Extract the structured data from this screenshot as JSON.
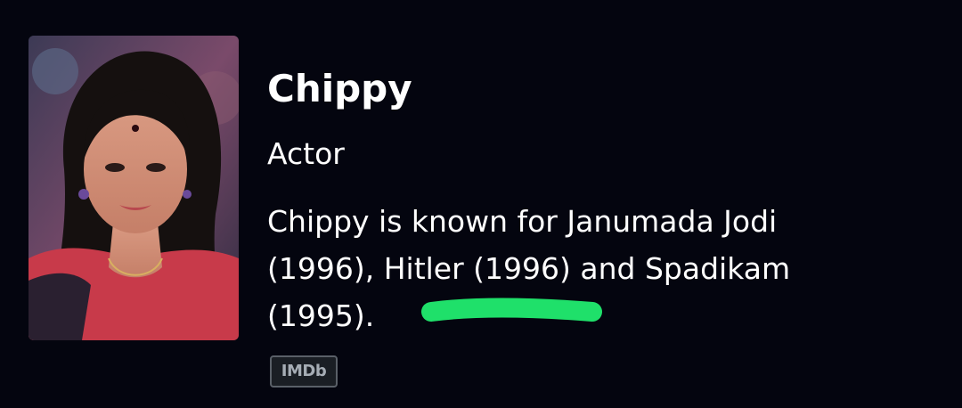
{
  "person": {
    "name": "Chippy",
    "role": "Actor",
    "bio_lines": [
      "Chippy is known for Janumada Jodi",
      "(1996), Hitler (1996) and Spadikam",
      "(1995)."
    ]
  },
  "source_badge": {
    "label": "IMDb"
  },
  "colors": {
    "background": "#04050f",
    "text": "#ffffff",
    "highlight_stroke": "#1fe06a",
    "badge_border": "#5a6068",
    "badge_text": "#a6adb5"
  },
  "icons": {
    "profile_photo": "person-photo",
    "annotation": "green-marker-stroke"
  }
}
